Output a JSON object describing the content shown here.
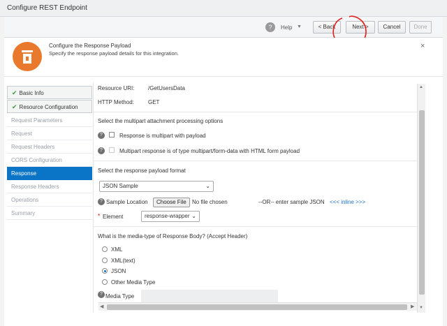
{
  "window": {
    "title": "Configure REST Endpoint"
  },
  "toolbar": {
    "help_label": "Help",
    "back_label": "< Back",
    "next_label": "Next >",
    "cancel_label": "Cancel",
    "done_label": "Done"
  },
  "header": {
    "title": "Configure the Response Payload",
    "subtitle": "Specify the response payload details for this integration.",
    "close": "×"
  },
  "nav": {
    "items": [
      {
        "label": "Basic Info",
        "state": "done"
      },
      {
        "label": "Resource Configuration",
        "state": "done"
      },
      {
        "label": "Request Parameters",
        "state": "disabled"
      },
      {
        "label": "Request",
        "state": "disabled"
      },
      {
        "label": "Request Headers",
        "state": "disabled"
      },
      {
        "label": "CORS Configuration",
        "state": "disabled"
      },
      {
        "label": "Response",
        "state": "active"
      },
      {
        "label": "Response Headers",
        "state": "disabled"
      },
      {
        "label": "Operations",
        "state": "disabled"
      },
      {
        "label": "Summary",
        "state": "disabled"
      }
    ]
  },
  "form": {
    "resource_uri_label": "Resource URI:",
    "resource_uri_value": "/GetUsersData",
    "http_method_label": "HTTP Method:",
    "http_method_value": "GET",
    "multipart_heading": "Select the multipart attachment processing options",
    "multipart_option1": "Response is multipart with payload",
    "multipart_option2": "Multipart response is of type multipart/form-data with HTML form payload",
    "payload_format_heading": "Select the response payload format",
    "payload_format_value": "JSON Sample",
    "sample_location_label": "Sample Location",
    "choose_file_label": "Choose File",
    "no_file_label": "No file chosen",
    "or_enter_label": "--OR-- enter sample JSON",
    "inline_link": "<<< inline >>>",
    "element_required": "*",
    "element_label": "Element",
    "element_value": "response-wrapper",
    "media_type_heading": "What is the media-type of Response Body? (Accept Header)",
    "media_options": [
      "XML",
      "XML(text)",
      "JSON",
      "Other Media Type"
    ],
    "media_selected": "JSON",
    "media_type_label": "Media Type"
  },
  "colors": {
    "accent": "#0a74c7",
    "icon_orange": "#e97a2d",
    "check_green": "#3c9a3c",
    "annotation_red": "#e0201b"
  }
}
